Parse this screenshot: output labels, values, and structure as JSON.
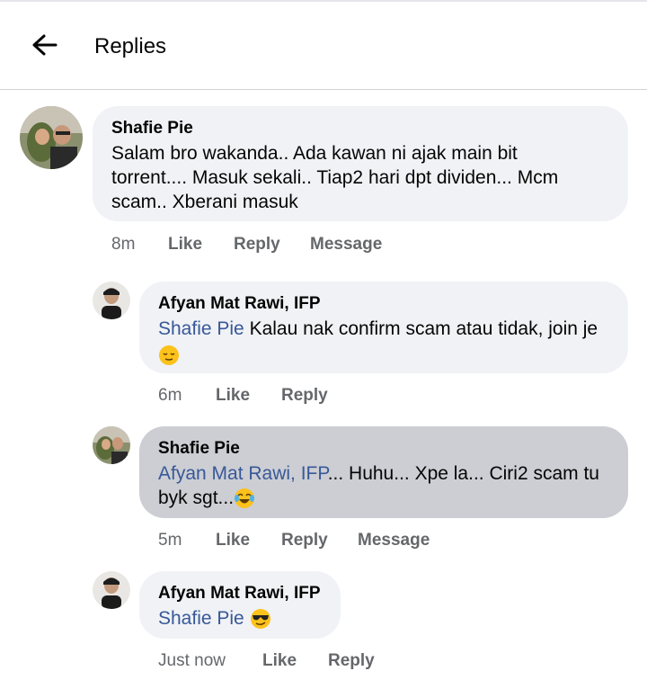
{
  "header": {
    "title": "Replies",
    "back_icon": "arrow-left-icon"
  },
  "colors": {
    "mention": "#385898",
    "bubble": "#f0f2f5",
    "bubble_highlight": "#ccced3",
    "meta": "#65676b"
  },
  "comments": [
    {
      "author": "Shafie Pie",
      "lines": [
        "Salam bro wakanda.. Ada kawan ni ajak main bit",
        "torrent.... Masuk sekali.. Tiap2 hari dpt dividen... Mcm",
        "scam.. Xberani masuk"
      ],
      "time": "8m",
      "like": "Like",
      "reply": "Reply",
      "message": "Message"
    },
    {
      "author": "Afyan Mat Rawi, IFP",
      "mention": "Shafie Pie",
      "line1": "Kalau nak confirm scam atau tidak, join je",
      "emoji": "relieved-face-emoji",
      "time": "6m",
      "like": "Like",
      "reply": "Reply"
    },
    {
      "author": "Shafie Pie",
      "mention": "Afyan Mat Rawi, IFP",
      "line1": "... Huhu... Xpe la... Ciri2 scam tu",
      "line2": "byk sgt...",
      "emoji": "tears-of-joy-emoji",
      "time": "5m",
      "like": "Like",
      "reply": "Reply",
      "message": "Message"
    },
    {
      "author": "Afyan Mat Rawi, IFP",
      "mention": "Shafie Pie",
      "emoji": "sunglasses-face-emoji",
      "time": "Just now",
      "like": "Like",
      "reply": "Reply"
    }
  ]
}
